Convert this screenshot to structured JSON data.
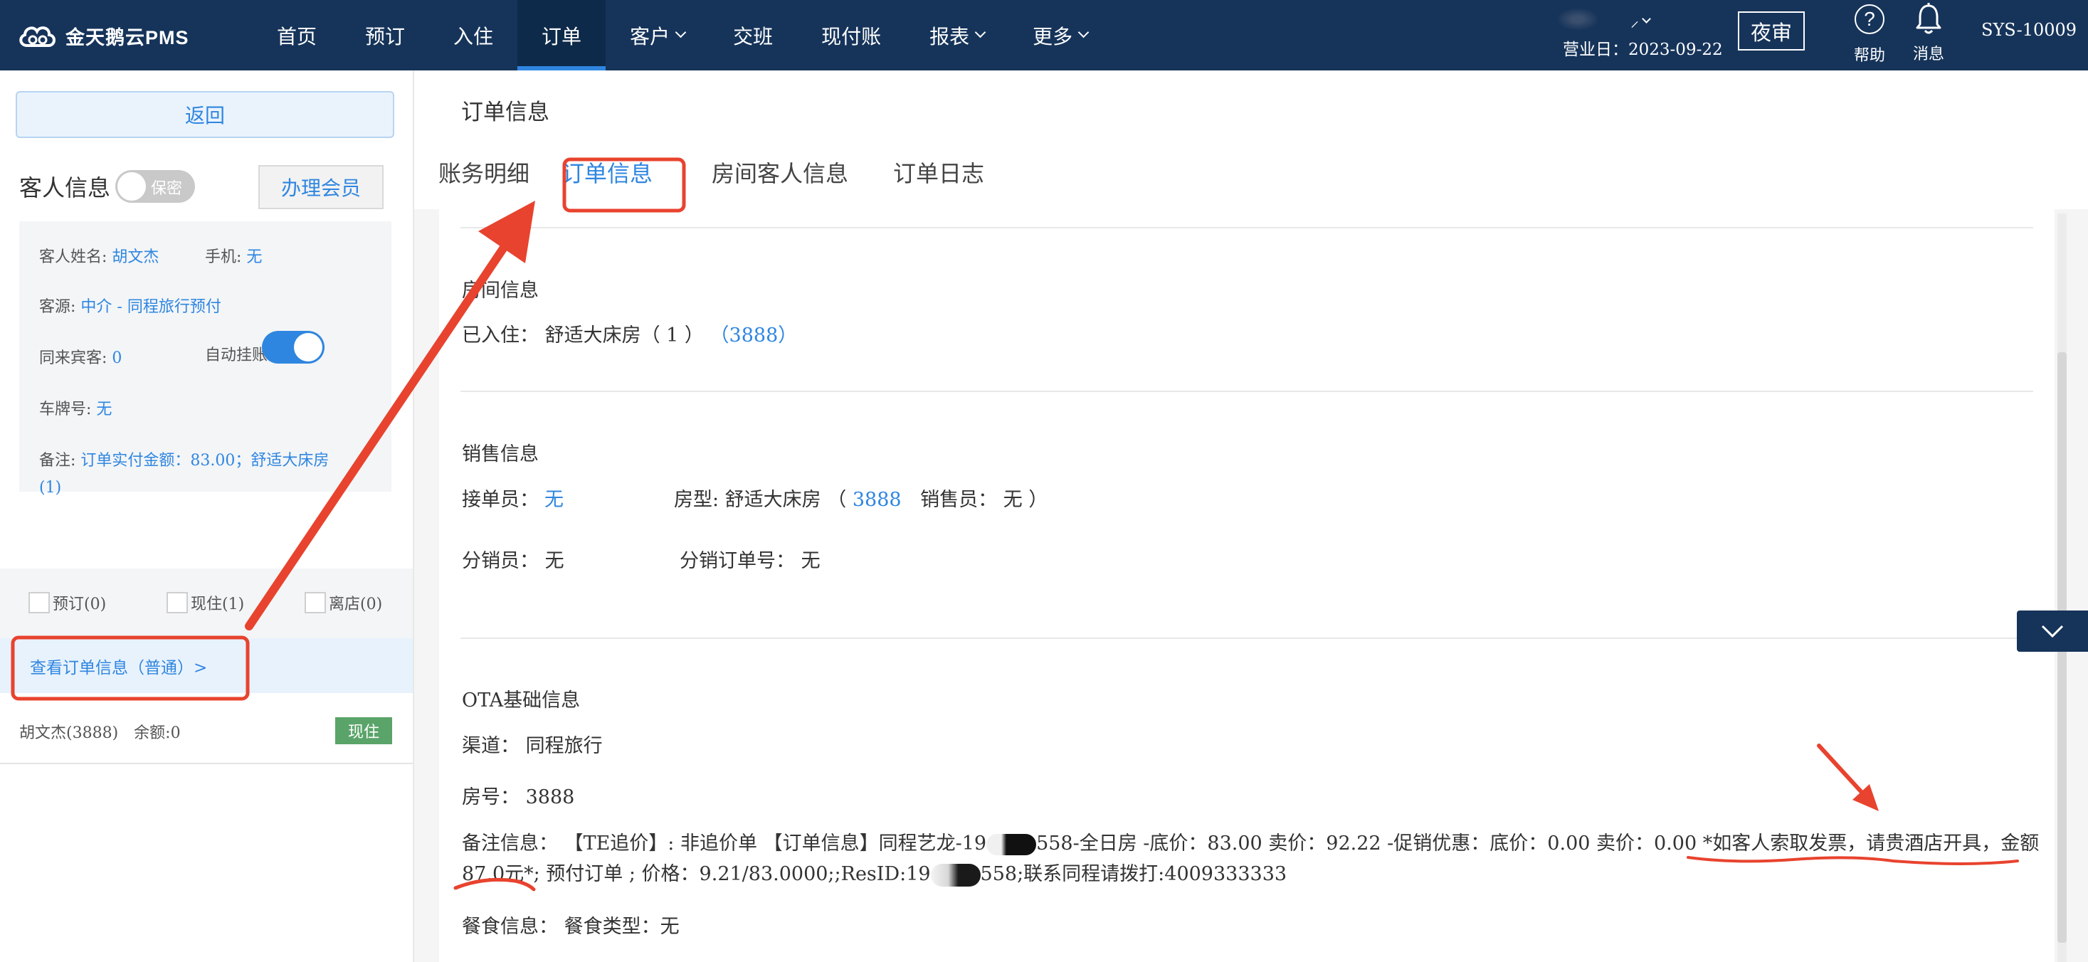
{
  "app": {
    "logo_text": "金天鹅云PMS"
  },
  "nav": {
    "items": [
      {
        "label": "首页",
        "has_dropdown": false
      },
      {
        "label": "预订",
        "has_dropdown": false
      },
      {
        "label": "入住",
        "has_dropdown": false
      },
      {
        "label": "订单",
        "has_dropdown": false,
        "active": true
      },
      {
        "label": "客户",
        "has_dropdown": true
      },
      {
        "label": "交班",
        "has_dropdown": false
      },
      {
        "label": "现付账",
        "has_dropdown": false
      },
      {
        "label": "报表",
        "has_dropdown": true
      },
      {
        "label": "更多",
        "has_dropdown": true
      }
    ]
  },
  "topbar": {
    "business_date": "营业日：2023-09-22",
    "night_audit_label": "夜审",
    "help_label": "帮助",
    "message_label": "消息",
    "sys_id": "SYS-10009"
  },
  "left_panel": {
    "back_label": "返回",
    "guest_info_title": "客人信息",
    "secret_toggle_label": "保密",
    "secret_on": false,
    "member_button_label": "办理会员",
    "guest_name_label": "客人姓名:",
    "guest_name": "胡文杰",
    "phone_label": "手机:",
    "phone": "无",
    "source_label": "客源:",
    "source": "中介 - 同程旅行预付",
    "companions_label": "同来宾客:",
    "companions": "0",
    "auto_charge_label": "自动挂账:",
    "auto_charge_on": true,
    "plate_label": "车牌号:",
    "plate": "无",
    "remark_label": "备注:",
    "remark": "订单实付金额：83.00；舒适大床房(1)",
    "filters": [
      {
        "label": "预订(0)",
        "checked": false
      },
      {
        "label": "现住(1)",
        "checked": false
      },
      {
        "label": "离店(0)",
        "checked": false
      }
    ],
    "order_link": "查看订单信息（普通）>",
    "order_row": {
      "name": "胡文杰(3888)　余额:0",
      "status": "现住"
    }
  },
  "right_panel": {
    "page_title": "订单信息",
    "tabs": [
      {
        "label": "账务明细",
        "active": false
      },
      {
        "label": "订单信息",
        "active": true
      },
      {
        "label": "房间客人信息",
        "active": false
      },
      {
        "label": "订单日志",
        "active": false
      }
    ],
    "room_section": {
      "title": "房间信息",
      "checked_in_label": "已入住：",
      "room_type": "舒适大床房（ 1 ）",
      "room_no": "（3888）"
    },
    "sales_section": {
      "title": "销售信息",
      "receiver_label": "接单员：",
      "receiver": "无",
      "room_type_prefix": "房型: 舒适大床房 （",
      "room_no": "3888",
      "salesperson_suffix": "销售员：  无  ）",
      "distributor_label": "分销员：",
      "distributor": "无",
      "distributor_order_label": "分销订单号：",
      "distributor_order": "无"
    },
    "ota_section": {
      "title": "OTA基础信息",
      "channel_label": "渠道：",
      "channel": "同程旅行",
      "room_label": "房号：",
      "room": "3888",
      "remark_label": "备注信息：",
      "remark_part1": "【TE追价】: 非追价单 【订单信息】同程艺龙-19",
      "remark_part2": "558-全日房 -底价：83.00 卖价：92.22 -促销优惠：底价：0.00 卖价：0.00 *如客人索取发票，请贵酒店开具，金额",
      "remark_part3": "87.0元*;  预付订单 ;  价格：9.21/83.0000;;ResID:19",
      "remark_part4": "558;联系同程请拨打:4009333333",
      "meal_label": "餐食信息：",
      "meal_text": "餐食类型：无"
    }
  },
  "colors": {
    "topbar": "#16345a",
    "accent": "#2f86e0",
    "annotation": "#e8432e",
    "status_green": "#5aa469"
  }
}
